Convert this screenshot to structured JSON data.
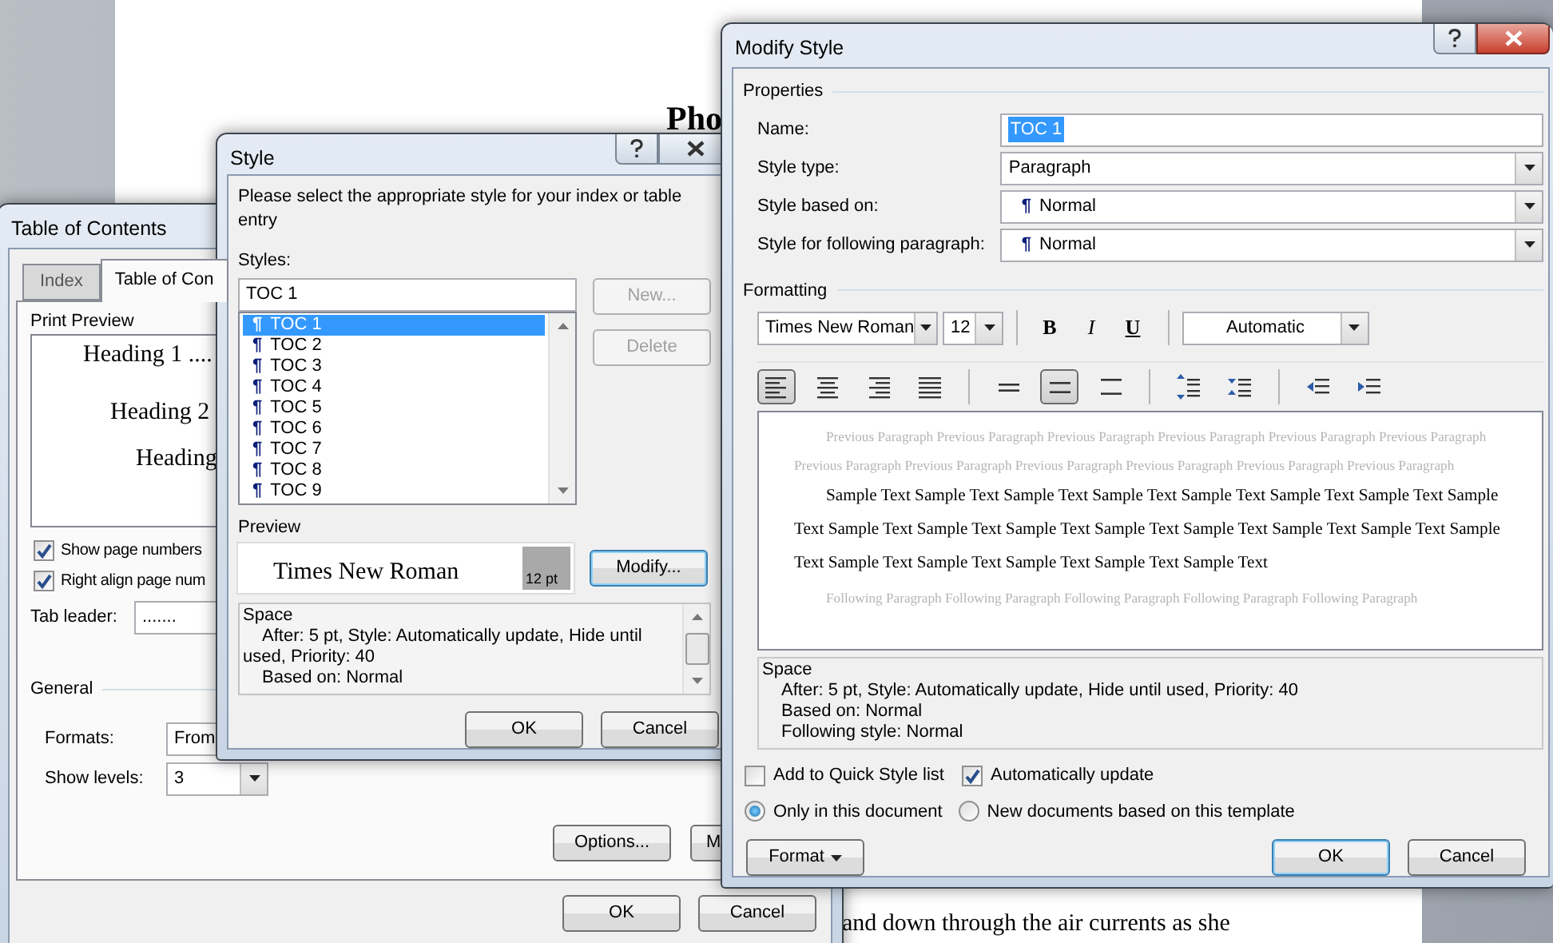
{
  "document": {
    "heading": "Pho",
    "body_line": "and down through the air currents as she"
  },
  "toc_dialog": {
    "title": "Table of Contents",
    "tabs": [
      {
        "label": "Index",
        "selected": false
      },
      {
        "label": "Table of Con",
        "selected": true
      }
    ],
    "print_preview": {
      "label": "Print Preview",
      "lines": [
        "Heading 1 ....",
        "Heading 2",
        "Heading"
      ]
    },
    "options": [
      {
        "label": "Show page numbers",
        "checked": true
      },
      {
        "label": "Right align page num",
        "checked": true
      }
    ],
    "tab_leader": {
      "label": "Tab leader:",
      "value": "......."
    },
    "general": {
      "label": "General",
      "formats": {
        "label": "Formats:",
        "value": "From"
      },
      "show_levels": {
        "label": "Show levels:",
        "value": "3"
      }
    },
    "buttons": [
      "Options...",
      "M"
    ],
    "footer_buttons": [
      "OK",
      "Cancel"
    ]
  },
  "style_dialog": {
    "title": "Style",
    "instruction": "Please select the appropriate style for your index or table entry",
    "styles_label": "Styles:",
    "style_name": "TOC 1",
    "styles": [
      {
        "mark": "¶",
        "label": "TOC 1",
        "selected": true
      },
      {
        "mark": "¶",
        "label": "TOC 2",
        "selected": false
      },
      {
        "mark": "¶",
        "label": "TOC 3",
        "selected": false
      },
      {
        "mark": "¶",
        "label": "TOC 4",
        "selected": false
      },
      {
        "mark": "¶",
        "label": "TOC 5",
        "selected": false
      },
      {
        "mark": "¶",
        "label": "TOC 6",
        "selected": false
      },
      {
        "mark": "¶",
        "label": "TOC 7",
        "selected": false
      },
      {
        "mark": "¶",
        "label": "TOC 8",
        "selected": false
      },
      {
        "mark": "¶",
        "label": "TOC 9",
        "selected": false
      }
    ],
    "side_buttons": [
      {
        "label": "New...",
        "disabled": true
      },
      {
        "label": "Delete",
        "disabled": true
      }
    ],
    "preview": {
      "label": "Preview",
      "font": "Times New Roman",
      "size": "12 pt"
    },
    "modify_button": "Modify...",
    "description": {
      "heading": "Space",
      "text": "After:  5 pt, Style: Automatically update, Hide until used, Priority: 40",
      "lines": [
        "Based on: Normal"
      ]
    },
    "footer_buttons": [
      "OK",
      "Cancel"
    ]
  },
  "modify_dialog": {
    "title": "Modify Style",
    "properties_label": "Properties",
    "properties": [
      {
        "kind": "text",
        "label": "Name:",
        "value": "TOC 1"
      },
      {
        "kind": "select",
        "label": "Style type:",
        "value": "Paragraph"
      },
      {
        "kind": "select",
        "label": "Style based on:",
        "mark": "¶",
        "value": "Normal"
      },
      {
        "kind": "select",
        "label": "Style for following paragraph:",
        "mark": "¶",
        "value": "Normal"
      }
    ],
    "formatting_label": "Formatting",
    "font": "Times New Roman",
    "size": "12",
    "text_styles": [
      {
        "kind": "bold",
        "label": "B",
        "selected": false
      },
      {
        "kind": "italic",
        "label": "I",
        "selected": false
      },
      {
        "kind": "underline",
        "label": "U",
        "selected": false
      }
    ],
    "font_color_label": "Automatic",
    "paragraph_buttons": [
      {
        "kind": "align-left",
        "selected": true
      },
      {
        "kind": "align-center",
        "selected": false
      },
      {
        "kind": "align-right",
        "selected": false
      },
      {
        "kind": "justify",
        "selected": false
      },
      {
        "kind": "single-spacing",
        "selected": false
      },
      {
        "kind": "one-half-spacing",
        "selected": true
      },
      {
        "kind": "double-spacing",
        "selected": false
      },
      {
        "kind": "increase-spacing",
        "selected": false
      },
      {
        "kind": "decrease-spacing",
        "selected": false
      },
      {
        "kind": "decrease-indent",
        "selected": false
      },
      {
        "kind": "increase-indent",
        "selected": false
      }
    ],
    "preview": {
      "previous": "Previous Paragraph Previous Paragraph Previous Paragraph Previous Paragraph Previous Paragraph Previous Paragraph Previous Paragraph Previous Paragraph Previous Paragraph Previous Paragraph Previous Paragraph Previous Paragraph",
      "sample": "Sample Text Sample Text Sample Text Sample Text Sample Text Sample Text Sample Text Sample Text Sample Text Sample Text Sample Text Sample Text Sample Text Sample Text Sample Text Sample Text Sample Text Sample Text Sample Text Sample Text Sample Text",
      "following": "Following Paragraph Following Paragraph Following Paragraph Following Paragraph Following Paragraph"
    },
    "description": {
      "heading": "Space",
      "lines": [
        "After:  5 pt, Style: Automatically update, Hide until used, Priority: 40",
        "Based on: Normal",
        "Following style: Normal"
      ]
    },
    "checkboxes": [
      {
        "label": "Add to Quick Style list",
        "checked": false
      },
      {
        "label": "Automatically update",
        "checked": true
      }
    ],
    "radios": [
      {
        "label": "Only in this document",
        "selected": true
      },
      {
        "label": "New documents based on this template",
        "selected": false
      }
    ],
    "format_button": "Format",
    "footer_buttons": [
      "OK",
      "Cancel"
    ]
  }
}
